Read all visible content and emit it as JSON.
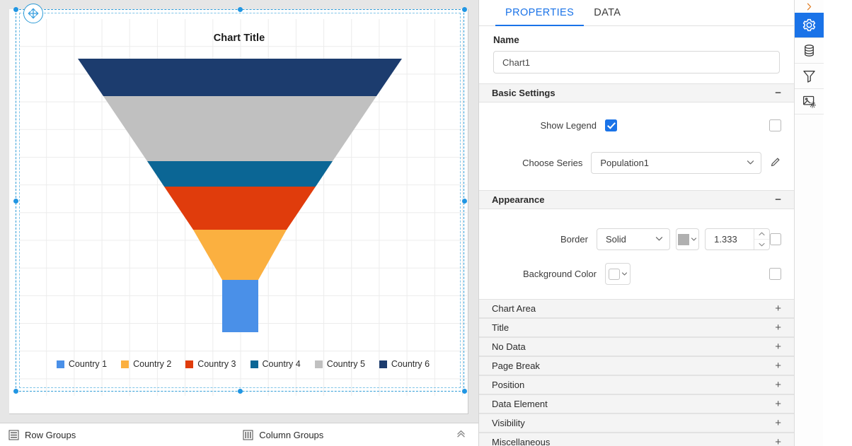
{
  "designer": {
    "chart_title": "Chart Title",
    "move_handle_icon": "move-icon",
    "groups_bar": {
      "row_groups_label": "Row Groups",
      "row_groups_icon": "row-groups-icon",
      "column_groups_label": "Column Groups",
      "column_groups_icon": "column-groups-icon",
      "collapse_icon": "chevron-double-up-icon"
    }
  },
  "chart_data": {
    "type": "funnel",
    "title": "Chart Title",
    "xlabel": "",
    "ylabel": "",
    "legend_position": "bottom",
    "grid": true,
    "categories": [
      "Country 6",
      "Country 5",
      "Country 4",
      "Country 3",
      "Country 2",
      "Country 1"
    ],
    "legend_order": [
      "Country 1",
      "Country 2",
      "Country 3",
      "Country 4",
      "Country 5",
      "Country 6"
    ],
    "colors": {
      "Country 1": "#4a90e8",
      "Country 2": "#fbb040",
      "Country 3": "#e03c0c",
      "Country 4": "#0b6695",
      "Country 5": "#c0c0c0",
      "Country 6": "#1c3c6e"
    },
    "series": [
      {
        "name": "Population1",
        "values": [
          100,
          78,
          42,
          30,
          11,
          11
        ]
      }
    ],
    "segments": [
      {
        "label": "Country 6",
        "color": "#1c3c6e",
        "top_width": 458,
        "bottom_width": 386,
        "height": 53
      },
      {
        "label": "Country 5",
        "color": "#c0c0c0",
        "top_width": 386,
        "bottom_width": 262,
        "height": 92
      },
      {
        "label": "Country 4",
        "color": "#0b6695",
        "top_width": 262,
        "bottom_width": 214,
        "height": 36
      },
      {
        "label": "Country 3",
        "color": "#e03c0c",
        "top_width": 214,
        "bottom_width": 132,
        "height": 61
      },
      {
        "label": "Country 2",
        "color": "#fbb040",
        "top_width": 132,
        "bottom_width": 51,
        "height": 71
      },
      {
        "label": "Country 1",
        "color": "#4a90e8",
        "top_width": 51,
        "bottom_width": 51,
        "height": 74
      }
    ]
  },
  "panel": {
    "tabs": [
      {
        "label": "PROPERTIES",
        "active": true
      },
      {
        "label": "DATA",
        "active": false
      }
    ],
    "name_field": {
      "label": "Name",
      "value": "Chart1",
      "placeholder": "Name"
    },
    "basic_settings": {
      "title": "Basic Settings",
      "toggle": "−",
      "show_legend": {
        "label": "Show Legend",
        "checked": true,
        "expr_checked": false
      },
      "choose_series": {
        "label": "Choose Series",
        "value": "Population1",
        "chevron": "chevron-down-icon",
        "edit_icon": "pencil-icon"
      }
    },
    "appearance": {
      "title": "Appearance",
      "toggle": "−",
      "border": {
        "label": "Border",
        "style_value": "Solid",
        "color_swatch": "#b0b0b0",
        "width_value": "1.333",
        "expr_checked": false
      },
      "background_color": {
        "label": "Background Color",
        "color_swatch": "#ffffff",
        "expr_checked": false
      }
    },
    "collapsed_sections": [
      {
        "label": "Chart Area",
        "toggle": "+"
      },
      {
        "label": "Title",
        "toggle": "+"
      },
      {
        "label": "No Data",
        "toggle": "+"
      },
      {
        "label": "Page Break",
        "toggle": "+"
      },
      {
        "label": "Position",
        "toggle": "+"
      },
      {
        "label": "Data Element",
        "toggle": "+"
      },
      {
        "label": "Visibility",
        "toggle": "+"
      },
      {
        "label": "Miscellaneous",
        "toggle": "+"
      }
    ]
  },
  "rail": {
    "items": [
      {
        "icon": "chevron-right-icon",
        "active": false
      },
      {
        "icon": "gear-icon",
        "active": true
      },
      {
        "icon": "database-icon",
        "active": false
      },
      {
        "icon": "filter-funnel-icon",
        "active": false
      },
      {
        "icon": "image-settings-icon",
        "active": false
      }
    ]
  },
  "accent": "#1a73e8",
  "selection_color": "#2e9bd6"
}
